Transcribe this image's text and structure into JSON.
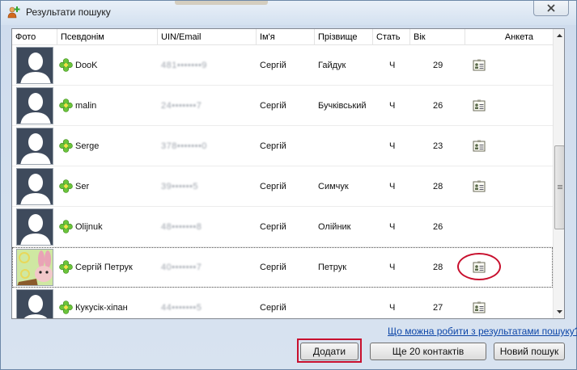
{
  "window": {
    "title": "Результати пошуку",
    "close_icon": "close-icon"
  },
  "columns": [
    "Фото",
    "Псевдонім",
    "UIN/Email",
    "Ім'я",
    "Прізвище",
    "Стать",
    "Вік",
    "Анкета"
  ],
  "rows": [
    {
      "nick": "DooK",
      "uin": "481•••••••9",
      "first_name": "Сергій",
      "last_name": "Гайдук",
      "sex": "Ч",
      "age": "29",
      "avatar": "default",
      "has_anketa": true
    },
    {
      "nick": "malin",
      "uin": "24•••••••7",
      "first_name": "Сергій",
      "last_name": "Бучківський",
      "sex": "Ч",
      "age": "26",
      "avatar": "default",
      "has_anketa": true
    },
    {
      "nick": "Serge",
      "uin": "378•••••••0",
      "first_name": "Сергій",
      "last_name": "",
      "sex": "Ч",
      "age": "23",
      "avatar": "default",
      "has_anketa": true
    },
    {
      "nick": "Ser",
      "uin": "39••••••5",
      "first_name": "Сергій",
      "last_name": "Симчук",
      "sex": "Ч",
      "age": "28",
      "avatar": "default",
      "has_anketa": true
    },
    {
      "nick": "Olijnuk",
      "uin": "48•••••••8",
      "first_name": "Сергій",
      "last_name": "Олійник",
      "sex": "Ч",
      "age": "26",
      "avatar": "default",
      "has_anketa": false
    },
    {
      "nick": "Сергій Петрук",
      "uin": "40•••••••7",
      "first_name": "Сергій",
      "last_name": "Петрук",
      "sex": "Ч",
      "age": "28",
      "avatar": "cartoon",
      "has_anketa": true,
      "selected": true,
      "highlighted": true
    },
    {
      "nick": "Кукусік-хіпан",
      "uin": "44•••••••5",
      "first_name": "Сергій",
      "last_name": "",
      "sex": "Ч",
      "age": "27",
      "avatar": "default",
      "has_anketa": true
    }
  ],
  "help_link": "Що можна робити з результатами пошуку?",
  "buttons": {
    "add": "Додати",
    "more": "Ще 20 контактів",
    "new_search": "Новий пошук"
  },
  "colors": {
    "highlight": "#c8102e",
    "link": "#0d46a8",
    "online_flower": "#6bc43a"
  }
}
